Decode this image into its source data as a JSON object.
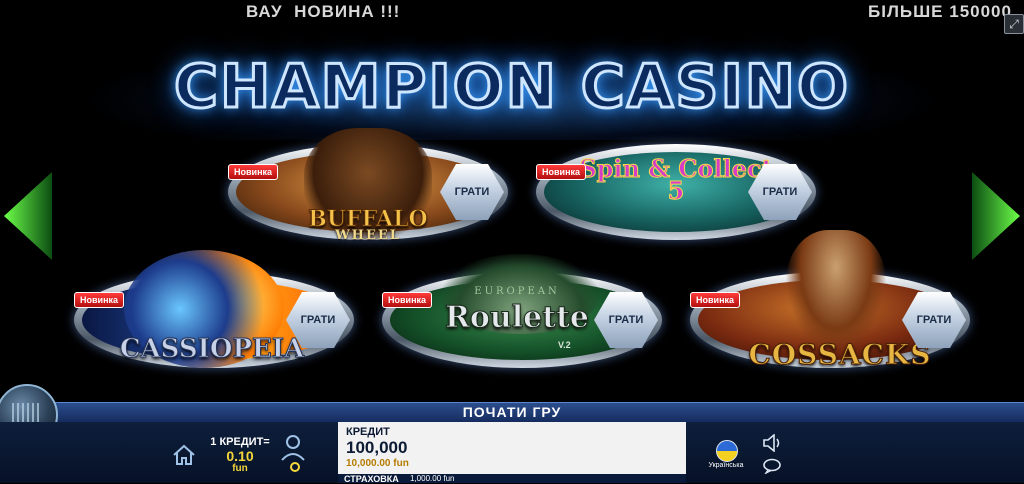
{
  "ticker": {
    "left_text": "ВАУ  НОВИНА !!!",
    "right_text": "БІЛЬШЕ 150000"
  },
  "logo": {
    "text": "CHAMPION CASINO"
  },
  "games": [
    {
      "id": "buffalo",
      "badge": "Новинка",
      "title": "BUFFALO",
      "subtitle": "WHEEL",
      "play_label": "ГРАТИ"
    },
    {
      "id": "spin",
      "badge": "Новинка",
      "title": "Spin & Collect 5",
      "play_label": "ГРАТИ"
    },
    {
      "id": "cassiopeia",
      "badge": "Новинка",
      "title": "CASSIOPEIA",
      "play_label": "ГРАТИ"
    },
    {
      "id": "roulette",
      "badge": "Новинка",
      "title": "Roulette",
      "subtitle": "EUROPEAN",
      "version": "V.2",
      "play_label": "ГРАТИ"
    },
    {
      "id": "cossacks",
      "badge": "Новинка",
      "title": "COSSACKS",
      "play_label": "ГРАТИ"
    }
  ],
  "bottom": {
    "start_label": "ПОЧАТИ ГРУ",
    "credit_rate_label": "1 КРЕДИТ=",
    "credit_rate_value": "0.10",
    "credit_rate_unit": "fun",
    "credit_label": "КРЕДИТ",
    "credit_value": "100,000",
    "credit_sub": "10,000.00 fun",
    "insurance_label": "СТРАХОВКА",
    "insurance_value": "1,000.00 fun",
    "language": "Українська"
  },
  "icons": [
    "fullscreen-icon",
    "arrow-left-icon",
    "arrow-right-icon",
    "home-icon",
    "account-settings-icon",
    "flag-icon",
    "sound-icon",
    "chat-icon"
  ],
  "colors": {
    "accent_blue": "#2c4e8e",
    "gold": "#f5d73c",
    "badge_red": "#d81b1b"
  }
}
